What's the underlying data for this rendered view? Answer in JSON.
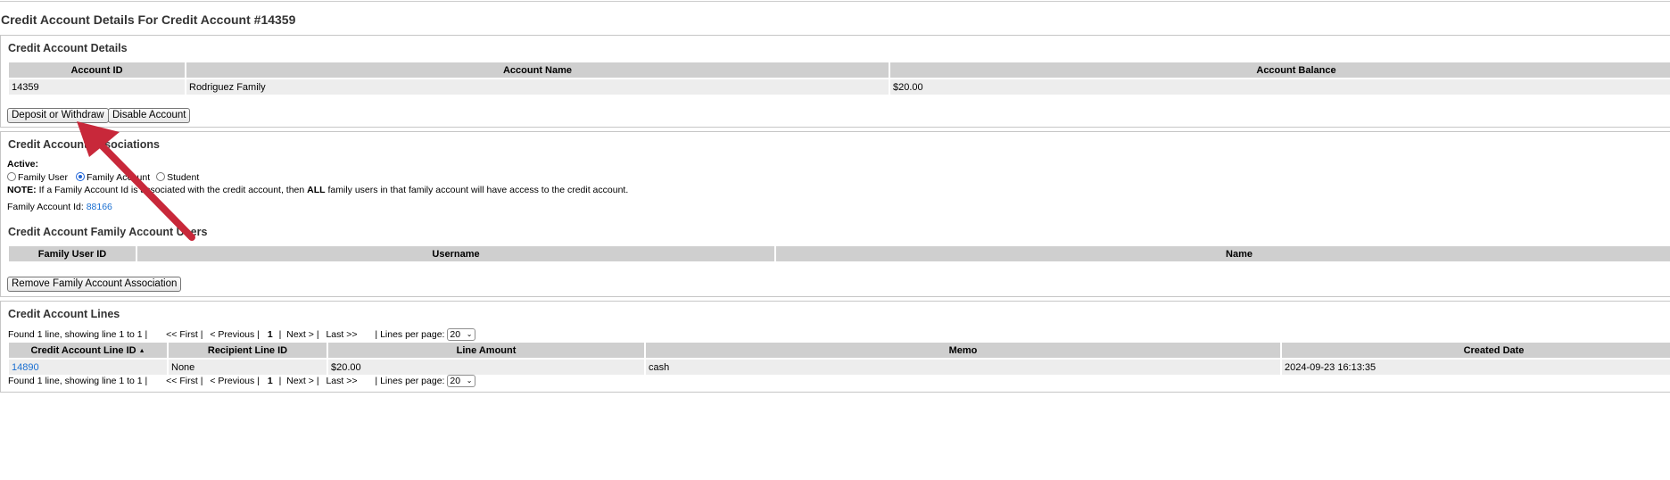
{
  "page": {
    "title": "Credit Account Details For Credit Account #14359"
  },
  "details": {
    "title": "Credit Account Details",
    "columns": [
      "Account ID",
      "Account Name",
      "Account Balance"
    ],
    "row": [
      "14359",
      "Rodriguez Family",
      "$20.00"
    ],
    "deposit_button": "Deposit or Withdraw",
    "disable_button": "Disable Account"
  },
  "associations": {
    "title": "Credit Account Associations",
    "active_label": "Active:",
    "radio_options": [
      "Family User",
      "Family Account",
      "Student"
    ],
    "selected_option": "Family Account",
    "note_prefix": "NOTE:",
    "note_part1": " If a Family Account Id is associated with the credit account, then ",
    "note_bold": "ALL",
    "note_part2": " family users in that family account will have access to the credit account.",
    "family_account_label": "Family Account Id: ",
    "family_account_id": "88166"
  },
  "family_users": {
    "title": "Credit Account Family Account Users",
    "columns": [
      "Family User ID",
      "Username",
      "Name"
    ],
    "remove_button": "Remove Family Account Association"
  },
  "lines": {
    "title": "Credit Account Lines",
    "found_text": "Found 1 line, showing line 1 to 1 |",
    "pager": {
      "first": "<< First",
      "sep1": "|",
      "previous": "< Previous",
      "sep2": "|",
      "current_page": "1",
      "sep3": "|",
      "next": "Next >",
      "sep4": "|",
      "last": "Last >>",
      "lines_per_page_label": "| Lines per page:",
      "lines_per_page_value": "20"
    },
    "columns": [
      "Credit Account Line ID",
      "Recipient Line ID",
      "Line Amount",
      "Memo",
      "Created Date"
    ],
    "rows": [
      [
        "14890",
        "None",
        "$20.00",
        "cash",
        "2024-09-23 16:13:35"
      ]
    ]
  },
  "annotation": {
    "arrow_color": "#c8283a"
  }
}
